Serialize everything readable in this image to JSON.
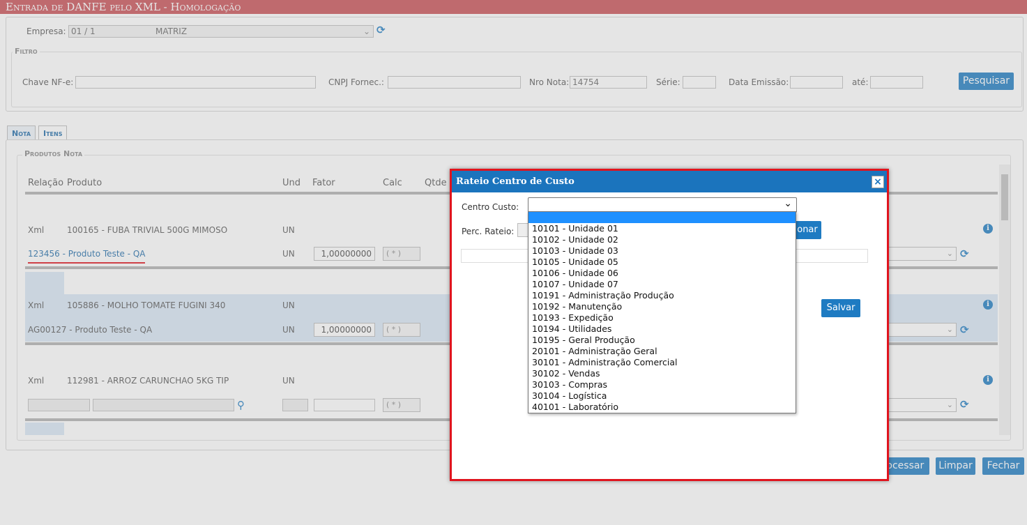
{
  "window_title": "Entrada de DANFE pelo XML  - Homologação",
  "empresa": {
    "label": "Empresa:",
    "value": "01 / 1",
    "value2": "MATRIZ"
  },
  "filtro": {
    "legend": "Filtro",
    "chave_label": "Chave NF-e:",
    "cnpj_label": "CNPJ Fornec.:",
    "nro_label": "Nro Nota:",
    "nro_value": "14754",
    "serie_label": "Série:",
    "data_label": "Data Emissão:",
    "ate_label": "até:",
    "search_button": "Pesquisar"
  },
  "tabs": [
    {
      "label": "Nota"
    },
    {
      "label": "Itens"
    }
  ],
  "produtos": {
    "legend": "Produtos Nota",
    "headers": [
      "Relação",
      "Produto",
      "Und",
      "Fator",
      "Calc",
      "Qtde"
    ],
    "rows": [
      {
        "relacao": "Xml",
        "produto": "100165 - FUBA TRIVIAL 500G MIMOSO",
        "und": "UN"
      },
      {
        "relacao": "123456 - Produto Teste - QA",
        "und": "UN",
        "fator": "1,00000000",
        "calc": "( * )"
      },
      {
        "relacao": "Xml",
        "produto": "105886 - MOLHO TOMATE FUGINI 340",
        "und": "UN"
      },
      {
        "relacao": "AG00127 - Produto Teste - QA",
        "und": "UN",
        "fator": "1,00000000",
        "calc": "( * )"
      },
      {
        "relacao": "Xml",
        "produto": "112981 - ARROZ CARUNCHAO 5KG TIP",
        "und": "UN"
      },
      {
        "calc": "( * )"
      }
    ]
  },
  "footer": {
    "processar": "Processar",
    "limpar": "Limpar",
    "fechar": "Fechar"
  },
  "modal": {
    "title": "Rateio Centro de Custo",
    "centro_label": "Centro Custo:",
    "perc_label": "Perc. Rateio:",
    "add_button_partial": "onar",
    "save_button": "Salvar",
    "options": [
      "",
      "10101 - Unidade 01",
      "10102 - Unidade 02",
      "10103 - Unidade 03",
      "10105 - Unidade 05",
      "10106 - Unidade 06",
      "10107 - Unidade 07",
      "10191 - Administração Produção",
      "10192 - Manutenção",
      "10193 - Expedição",
      "10194 - Utilidades",
      "10195 - Geral Produção",
      "20101 - Administração Geral",
      "30101 - Administração Comercial",
      "30102 - Vendas",
      "30103 - Compras",
      "30104 - Logística",
      "40101 - Laboratório"
    ]
  },
  "colors": {
    "accent": "#1e7bc2",
    "title_bar": "#c94f55",
    "modal_border": "#e0141e"
  }
}
